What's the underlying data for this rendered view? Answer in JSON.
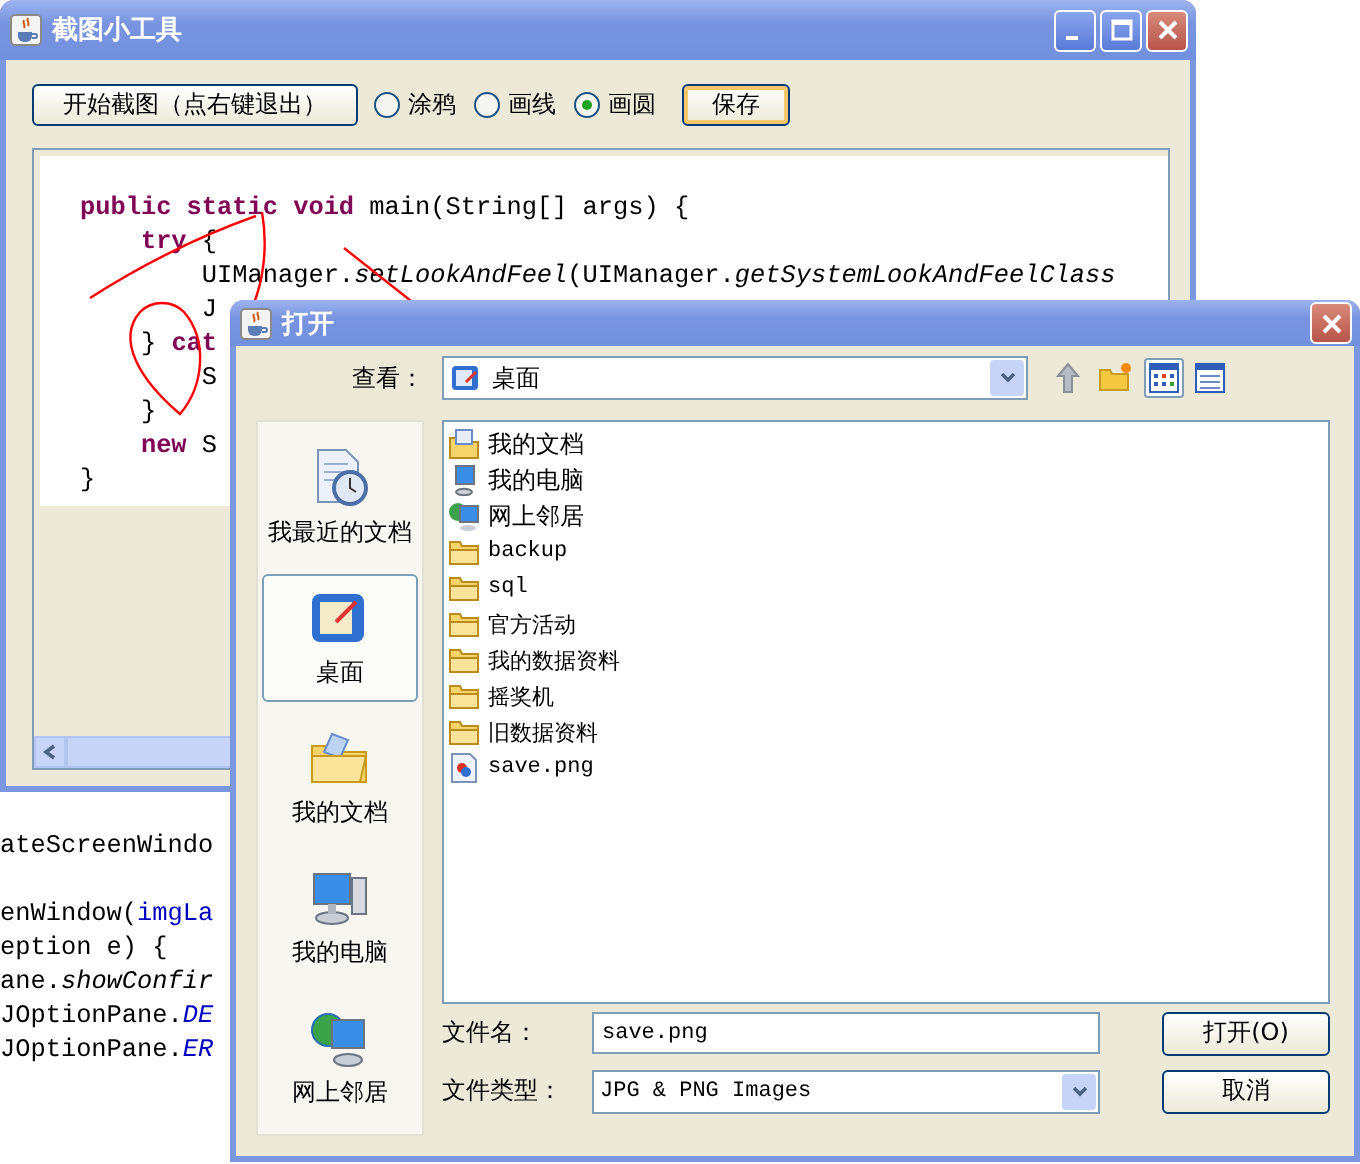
{
  "main_window": {
    "title": "截图小工具",
    "toolbar": {
      "start_button": "开始截图（点右键退出）",
      "modes": [
        {
          "label": "涂鸦",
          "selected": false
        },
        {
          "label": "画线",
          "selected": false
        },
        {
          "label": "画圆",
          "selected": true
        }
      ],
      "save_button": "保存"
    },
    "code_lines": [
      {
        "segments": [
          {
            "text": "public static void",
            "kind": "keyword"
          },
          {
            "text": " main(String[] args) {",
            "kind": "plain"
          }
        ]
      },
      {
        "segments": [
          {
            "text": "    try",
            "kind": "keyword"
          },
          {
            "text": " {",
            "kind": "plain"
          }
        ]
      },
      {
        "segments": [
          {
            "text": "        UIManager.",
            "kind": "plain"
          },
          {
            "text": "setLookAndFeel",
            "kind": "method"
          },
          {
            "text": "(UIManager.",
            "kind": "plain"
          },
          {
            "text": "getSystemLookAndFeelClass",
            "kind": "method"
          }
        ]
      },
      {
        "segments": [
          {
            "text": "        J",
            "kind": "plain"
          }
        ]
      },
      {
        "segments": [
          {
            "text": "    } ",
            "kind": "plain"
          },
          {
            "text": "cat",
            "kind": "keyword"
          }
        ]
      },
      {
        "segments": [
          {
            "text": "        S",
            "kind": "plain"
          }
        ]
      },
      {
        "segments": [
          {
            "text": "    }",
            "kind": "plain"
          }
        ]
      },
      {
        "segments": [
          {
            "text": "    new",
            "kind": "keyword"
          },
          {
            "text": " S",
            "kind": "plain"
          }
        ]
      },
      {
        "segments": [
          {
            "text": "}",
            "kind": "plain"
          }
        ]
      }
    ]
  },
  "background_code_lines": [
    {
      "segments": [
        {
          "text": "ateScreenWindo",
          "kind": "plain"
        }
      ]
    },
    {
      "blank_before": true,
      "segments": [
        {
          "text": "enWindow(",
          "kind": "plain"
        },
        {
          "text": "imgLa",
          "kind": "field"
        }
      ]
    },
    {
      "segments": [
        {
          "text": "eption e) {",
          "kind": "plain"
        }
      ]
    },
    {
      "segments": [
        {
          "text": "ane.",
          "kind": "plain"
        },
        {
          "text": "showConfir",
          "kind": "method"
        }
      ]
    },
    {
      "segments": [
        {
          "text": "JOptionPane.",
          "kind": "plain"
        },
        {
          "text": "DE",
          "kind": "constant"
        }
      ]
    },
    {
      "segments": [
        {
          "text": "JOptionPane.",
          "kind": "plain"
        },
        {
          "text": "ER",
          "kind": "constant"
        }
      ]
    }
  ],
  "dialog": {
    "title": "打开",
    "look_in_label": "查看：",
    "look_in_value": "桌面",
    "places": [
      {
        "label": "我最近的文档",
        "kind": "recent",
        "selected": false
      },
      {
        "label": "桌面",
        "kind": "desktop",
        "selected": true
      },
      {
        "label": "我的文档",
        "kind": "documents",
        "selected": false
      },
      {
        "label": "我的电脑",
        "kind": "computer",
        "selected": false
      },
      {
        "label": "网上邻居",
        "kind": "network",
        "selected": false
      }
    ],
    "files": [
      {
        "name": "我的文档",
        "kind": "documents"
      },
      {
        "name": "我的电脑",
        "kind": "computer"
      },
      {
        "name": "网上邻居",
        "kind": "network"
      },
      {
        "name": "backup",
        "kind": "folder"
      },
      {
        "name": "sql",
        "kind": "folder"
      },
      {
        "name": "官方活动",
        "kind": "folder"
      },
      {
        "name": "我的数据资料",
        "kind": "folder"
      },
      {
        "name": "摇奖机",
        "kind": "folder"
      },
      {
        "name": "旧数据资料",
        "kind": "folder"
      },
      {
        "name": "save.png",
        "kind": "image"
      }
    ],
    "file_name_label": "文件名：",
    "file_name": "save.png",
    "file_type_label": "文件类型：",
    "file_type": "JPG & PNG Images",
    "open_button": "打开(O)",
    "cancel_button": "取消"
  }
}
